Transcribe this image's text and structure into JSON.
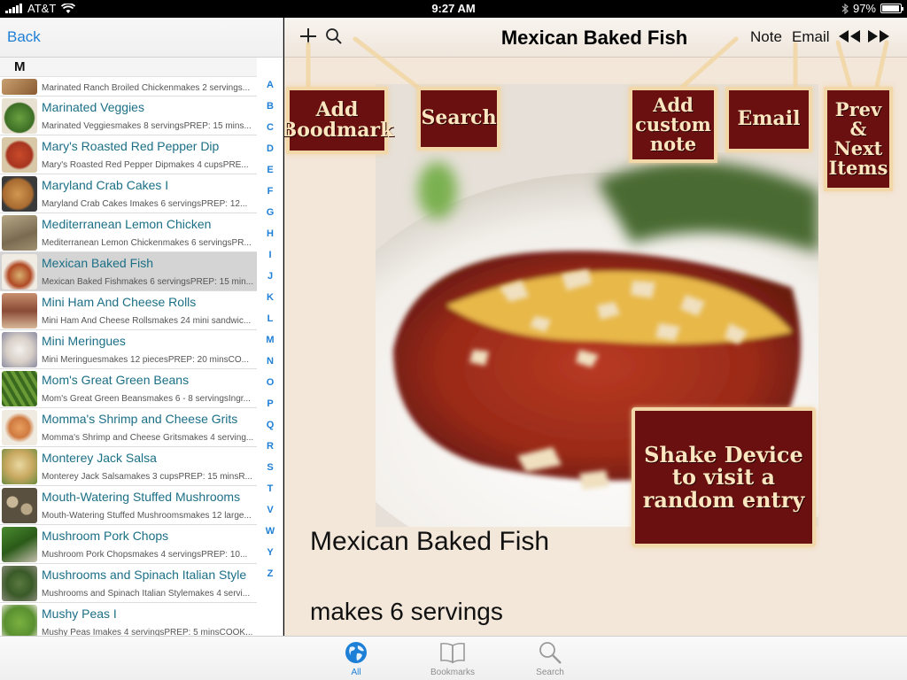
{
  "status": {
    "carrier": "AT&T",
    "time": "9:27 AM",
    "battery": "97%"
  },
  "left": {
    "back_label": "Back",
    "section": "M",
    "index_letters": [
      "A",
      "B",
      "C",
      "D",
      "E",
      "F",
      "G",
      "H",
      "I",
      "J",
      "K",
      "L",
      "M",
      "N",
      "O",
      "P",
      "Q",
      "R",
      "S",
      "T",
      "V",
      "W",
      "Y",
      "Z"
    ],
    "partial_sub": "Marinated Ranch Broiled Chickenmakes 2 servings...",
    "items": [
      {
        "title": "Marinated Veggies",
        "sub": "Marinated Veggiesmakes 8 servingsPREP: 15 mins..."
      },
      {
        "title": "Mary's Roasted Red Pepper Dip",
        "sub": "Mary's Roasted Red Pepper Dipmakes 4 cupsPRE..."
      },
      {
        "title": "Maryland Crab Cakes I",
        "sub": "Maryland Crab Cakes Imakes 6 servingsPREP: 12..."
      },
      {
        "title": "Mediterranean Lemon Chicken",
        "sub": "Mediterranean Lemon Chickenmakes 6 servingsPR..."
      },
      {
        "title": "Mexican Baked Fish",
        "sub": "Mexican Baked Fishmakes 6 servingsPREP: 15 min..."
      },
      {
        "title": "Mini Ham And Cheese Rolls",
        "sub": "Mini Ham And Cheese Rollsmakes 24 mini sandwic..."
      },
      {
        "title": "Mini Meringues",
        "sub": "Mini Meringuesmakes 12 piecesPREP: 20 minsCO..."
      },
      {
        "title": "Mom's Great Green Beans",
        "sub": "Mom's Great Green Beansmakes 6 - 8 servingsIngr..."
      },
      {
        "title": "Momma's Shrimp and Cheese Grits",
        "sub": "Momma's Shrimp and Cheese Gritsmakes 4 serving..."
      },
      {
        "title": "Monterey Jack Salsa",
        "sub": "Monterey Jack Salsamakes 3 cupsPREP: 15 minsR..."
      },
      {
        "title": "Mouth-Watering Stuffed Mushrooms",
        "sub": "Mouth-Watering Stuffed Mushroomsmakes 12 large..."
      },
      {
        "title": "Mushroom Pork Chops",
        "sub": "Mushroom Pork Chopsmakes 4 servingsPREP: 10..."
      },
      {
        "title": "Mushrooms and Spinach Italian Style",
        "sub": "Mushrooms and Spinach Italian Stylemakes 4 servi..."
      },
      {
        "title": "Mushy Peas I",
        "sub": "Mushy Peas Imakes 4 servingsPREP: 5 minsCOOK..."
      }
    ]
  },
  "right": {
    "title": "Mexican Baked Fish",
    "note_label": "Note",
    "email_label": "Email",
    "detail_title": "Mexican Baked Fish",
    "detail_servings": "makes 6 servings"
  },
  "callouts": {
    "bookmark": [
      "Add",
      "Boodmark"
    ],
    "search": [
      "Search"
    ],
    "note": [
      "Add",
      "custom",
      "note"
    ],
    "email": [
      "Email"
    ],
    "prevnext": [
      "Prev",
      "&",
      "Next",
      "Items"
    ],
    "shake": [
      "Shake Device",
      "to visit a",
      "random entry"
    ]
  },
  "tabs": [
    {
      "label": "All"
    },
    {
      "label": "Bookmarks"
    },
    {
      "label": "Search"
    }
  ],
  "colors": {
    "accent": "#1d7fd6",
    "callout_bg": "#6a1010",
    "callout_border": "#f2d8a8",
    "title_link": "#1b6f86"
  }
}
